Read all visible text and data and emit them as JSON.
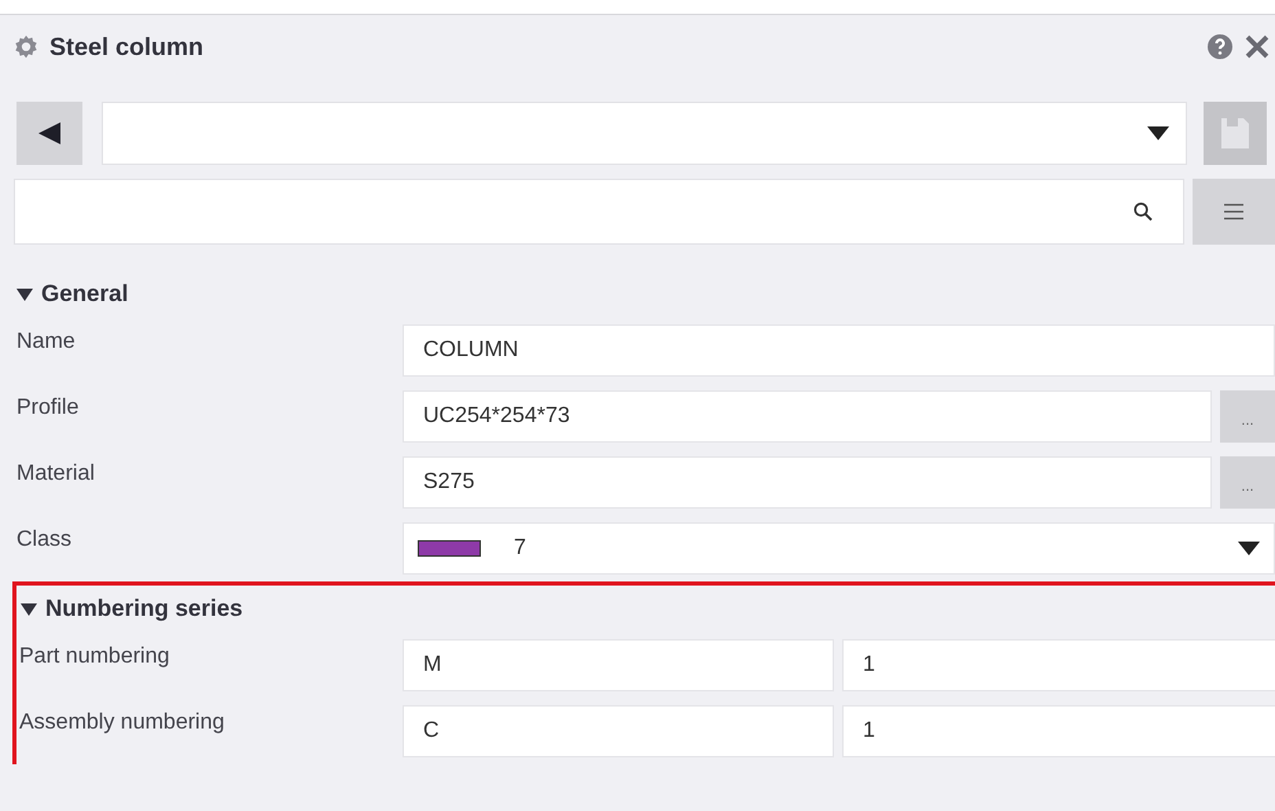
{
  "window": {
    "title": "Steel column"
  },
  "sections": [
    {
      "title": "General",
      "expanded": true,
      "highlighted": false,
      "rows": [
        {
          "kind": "text",
          "label": "Name",
          "value": "COLUMN"
        },
        {
          "kind": "browse",
          "label": "Profile",
          "value": "UC254*254*73",
          "button": "..."
        },
        {
          "kind": "browse",
          "label": "Material",
          "value": "S275",
          "button": "..."
        },
        {
          "kind": "class",
          "label": "Class",
          "value": "7",
          "color": "#8e3aa8"
        }
      ]
    },
    {
      "title": "Numbering series",
      "expanded": true,
      "highlighted": true,
      "rows": [
        {
          "kind": "pair",
          "label": "Part numbering",
          "value": "M",
          "value_2": "1"
        },
        {
          "kind": "pair",
          "label": "Assembly numbering",
          "value": "C",
          "value_2": "1"
        }
      ]
    }
  ]
}
